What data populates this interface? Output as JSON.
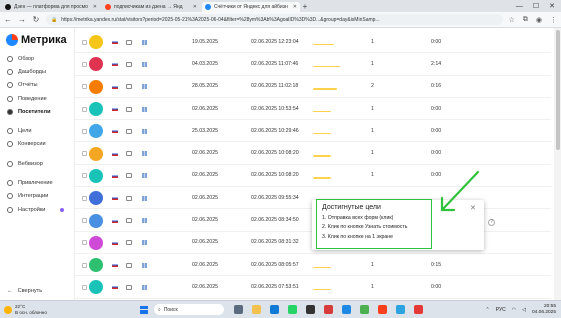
{
  "browser": {
    "tabs": [
      {
        "title": "Дзен — платформа для просмо",
        "icon": "dzen-icon",
        "color": "#111111",
        "active": false
      },
      {
        "title": "подписчикам из дзена → Янд",
        "icon": "yandex-icon",
        "color": "#fc3f1d",
        "active": false
      },
      {
        "title": "Счётчики от Яндекс для айбизн",
        "icon": "metrika-icon",
        "color": "#1e88ff",
        "active": true
      }
    ],
    "url": "https://metrika.yandex.ru/stat/visitors?period=2025-05-21%3A2025-06-04&filter=%28ym%3Ab%3AgoalID%3D%3D...&group=day&isMinSamp..."
  },
  "sidebar": {
    "logo": "Метрика",
    "items": [
      {
        "label": "Обзор",
        "icon": "grid-icon"
      },
      {
        "label": "Дашборды",
        "icon": "dashboard-icon"
      },
      {
        "label": "Отчёты",
        "icon": "reports-icon"
      },
      {
        "label": "Поведение",
        "icon": "behavior-icon"
      },
      {
        "label": "Посетители",
        "icon": "visitors-icon",
        "selected": true
      },
      {
        "label": "Цели",
        "icon": "target-icon"
      },
      {
        "label": "Конверсии",
        "icon": "conversion-icon"
      },
      {
        "label": "Вебвизор",
        "icon": "webvisor-icon"
      },
      {
        "label": "Привлечение",
        "icon": "acquisition-icon"
      },
      {
        "label": "Интеграции",
        "icon": "integrations-icon"
      },
      {
        "label": "Настройки",
        "icon": "settings-icon"
      }
    ],
    "collapse": "Свернуть"
  },
  "table": {
    "rows": [
      {
        "avatar": "#f5c518",
        "first": "19.05.2025",
        "last": "02.06.2025 12:23:04",
        "visits": "1",
        "time": "0:00",
        "visit_fill": 0.35
      },
      {
        "avatar": "#e0334f",
        "first": "04.03.2025",
        "last": "02.06.2025 11:07:46",
        "visits": "1",
        "time": "2:14",
        "visit_fill": 0.45
      },
      {
        "avatar": "#f57c00",
        "first": "28.05.2025",
        "last": "02.06.2025 11:02:18",
        "visits": "2",
        "time": "0:16",
        "visit_fill": 0.4
      },
      {
        "avatar": "#19c3b8",
        "first": "02.06.2025",
        "last": "02.06.2025 10:53:54",
        "visits": "1",
        "time": "0:00",
        "visit_fill": 0.3
      },
      {
        "avatar": "#3fa6e8",
        "first": "25.03.2025",
        "last": "02.06.2025 10:29:46",
        "visits": "1",
        "time": "0:00",
        "visit_fill": 0.3
      },
      {
        "avatar": "#f5a623",
        "first": "02.06.2025",
        "last": "02.06.2025 10:08:20",
        "visits": "1",
        "time": "0:00",
        "visit_fill": 0.3
      },
      {
        "avatar": "#19c3b8",
        "first": "02.06.2025",
        "last": "02.06.2025 10:08:20",
        "visits": "1",
        "time": "0:00",
        "visit_fill": 0.3
      },
      {
        "avatar": "#3f6fd8",
        "first": "02.06.2025",
        "last": "02.06.2025 09:55:34",
        "visits": "",
        "time": "",
        "visit_fill": 0.3
      },
      {
        "avatar": "#4a90e2",
        "first": "02.06.2025",
        "last": "02.06.2025 08:34:50",
        "visits": "",
        "time": "",
        "visit_fill": 0.3
      },
      {
        "avatar": "#d04ad8",
        "first": "02.06.2025",
        "last": "02.06.2025 08:31:32",
        "visits": "",
        "time": "",
        "visit_fill": 0.3
      },
      {
        "avatar": "#2fbf71",
        "first": "02.06.2025",
        "last": "02.06.2025 08:05:57",
        "visits": "1",
        "time": "0:15",
        "visit_fill": 0.3
      },
      {
        "avatar": "#19c3b8",
        "first": "02.06.2025",
        "last": "02.06.2025 07:53:51",
        "visits": "1",
        "time": "0:00",
        "visit_fill": 0.3
      }
    ]
  },
  "popup": {
    "title": "Достигнутые цели",
    "goals": [
      "1. Отправка всех форм (клик)",
      "2. Клик по кнопке Узнать стоимость",
      "3. Клик по кнопке на 1 экране"
    ],
    "highlight_color": "#2fc23a"
  },
  "taskbar": {
    "temp": "22°C",
    "weather": "В осн. облачно",
    "search_placeholder": "Поиск",
    "lang": "РУС",
    "time": "20:55",
    "date": "04.06.2025"
  }
}
